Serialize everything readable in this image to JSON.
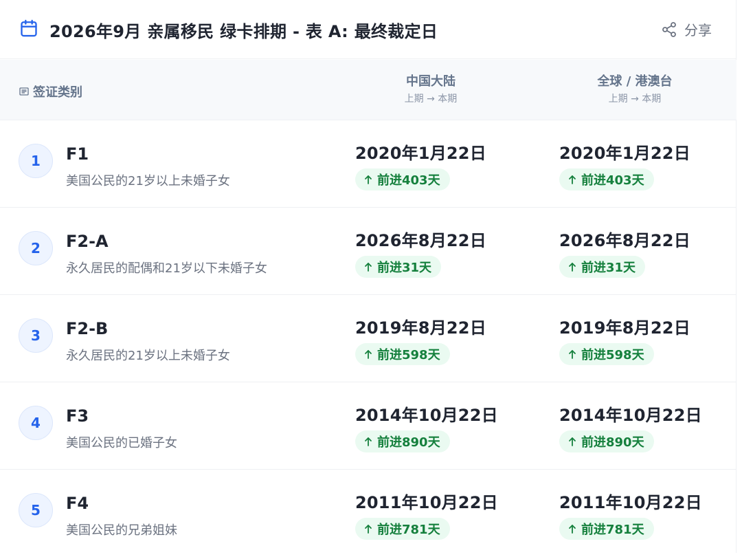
{
  "header": {
    "title": "2026年9月 亲属移民 绿卡排期 - 表 A: 最终裁定日",
    "share_label": "分享",
    "accent_color": "#2563eb"
  },
  "table_header": {
    "category_label": "签证类别",
    "china_label": "中国大陆",
    "global_label": "全球 / 港澳台",
    "period_sub": "上期 → 本期"
  },
  "rows": [
    {
      "index": "1",
      "code": "F1",
      "desc": "美国公民的21岁以上未婚子女",
      "china_date": "2020年1月22日",
      "china_change": "前进403天",
      "global_date": "2020年1月22日",
      "global_change": "前进403天"
    },
    {
      "index": "2",
      "code": "F2-A",
      "desc": "永久居民的配偶和21岁以下未婚子女",
      "china_date": "2026年8月22日",
      "china_change": "前进31天",
      "global_date": "2026年8月22日",
      "global_change": "前进31天"
    },
    {
      "index": "3",
      "code": "F2-B",
      "desc": "永久居民的21岁以上未婚子女",
      "china_date": "2019年8月22日",
      "china_change": "前进598天",
      "global_date": "2019年8月22日",
      "global_change": "前进598天"
    },
    {
      "index": "4",
      "code": "F3",
      "desc": "美国公民的已婚子女",
      "china_date": "2014年10月22日",
      "china_change": "前进890天",
      "global_date": "2014年10月22日",
      "global_change": "前进890天"
    },
    {
      "index": "5",
      "code": "F4",
      "desc": "美国公民的兄弟姐妹",
      "china_date": "2011年10月22日",
      "china_change": "前进781天",
      "global_date": "2011年10月22日",
      "global_change": "前进781天"
    }
  ],
  "icons": {
    "calendar": "calendar-icon",
    "share": "share-icon",
    "category": "list-icon",
    "advance": "arrow-up-icon"
  }
}
